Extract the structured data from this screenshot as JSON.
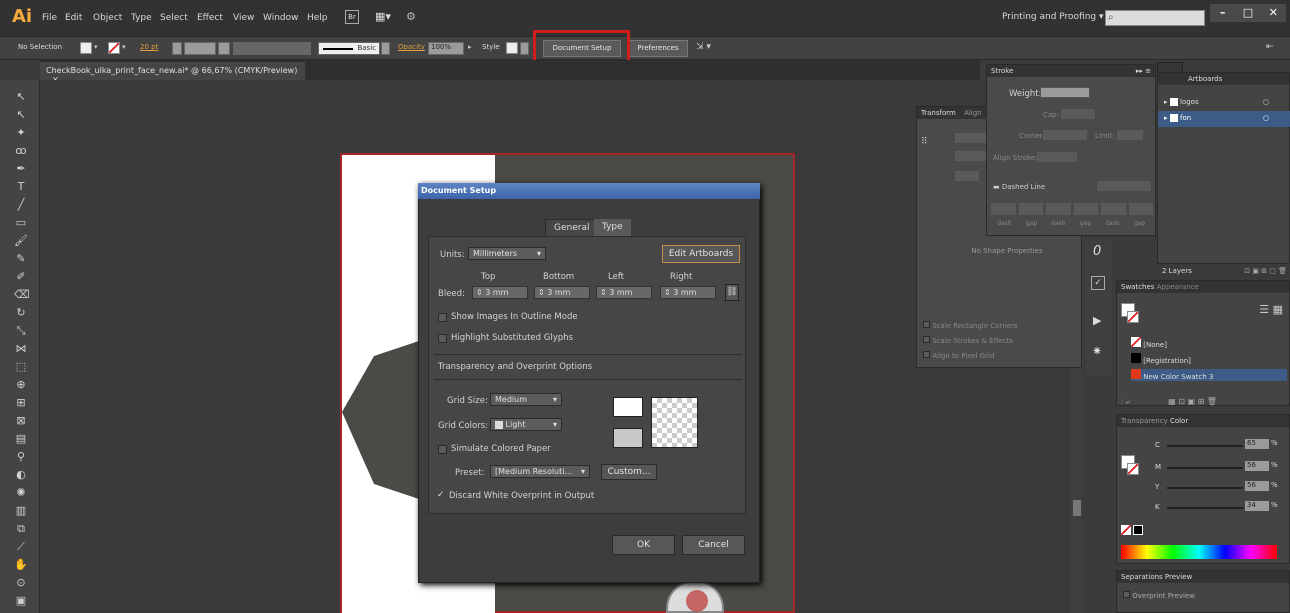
{
  "app": {
    "logo": "Ai",
    "menu": [
      "File",
      "Edit",
      "Object",
      "Type",
      "Select",
      "Effect",
      "View",
      "Window",
      "Help"
    ],
    "workspace": "Printing and Proofing",
    "window_buttons": [
      "–",
      "□",
      "✕"
    ]
  },
  "control_bar": {
    "no_selection": "No Selection",
    "stroke_size": "20 pt",
    "basic": "Basic",
    "opacity_label": "Opacity",
    "opacity_value": "100%",
    "style_label": "Style",
    "document_setup": "Document Setup",
    "preferences": "Preferences"
  },
  "document_tab": {
    "title": "CheckBook_ulka_print_face_new.ai* @ 66,67% (CMYK/Preview)",
    "close": "×"
  },
  "dialog": {
    "title": "Document Setup",
    "tabs": [
      "General",
      "Type"
    ],
    "units_label": "Units:",
    "units_value": "Millimeters",
    "edit_artboards": "Edit Artboards",
    "bleed_label": "Bleed:",
    "bleed_headers": [
      "Top",
      "Bottom",
      "Left",
      "Right"
    ],
    "bleed_values": [
      "3 mm",
      "3 mm",
      "3 mm",
      "3 mm"
    ],
    "show_images": "Show Images In Outline Mode",
    "highlight_glyphs": "Highlight Substituted Glyphs",
    "transparency_section": "Transparency and Overprint Options",
    "grid_size_label": "Grid Size:",
    "grid_size_value": "Medium",
    "grid_colors_label": "Grid Colors:",
    "grid_colors_value": "Light",
    "simulate_paper": "Simulate Colored Paper",
    "preset_label": "Preset:",
    "preset_value": "[Medium Resoluti...",
    "custom": "Custom...",
    "discard_white": "Discard White Overprint in Output",
    "ok": "OK",
    "cancel": "Cancel"
  },
  "stroke_panel": {
    "title": "Stroke",
    "weight": "Weight:",
    "cap": "Cap:",
    "corner": "Corner:",
    "limit": "Limit:",
    "align": "Align Stroke:",
    "dashed": "Dashed Line",
    "dash_labels": [
      "dash",
      "gap",
      "dash",
      "gap",
      "dash",
      "gap"
    ]
  },
  "transform_panel": {
    "title": "Transform",
    "tab2": "Align",
    "no_shape": "No Shape Properties",
    "options": [
      "Scale Rectangle Corners",
      "Scale Strokes & Effects",
      "Align to Pixel Grid"
    ]
  },
  "layers_panel": {
    "tab": "Artboards",
    "layers": [
      "logos",
      "fon"
    ],
    "count": "2 Layers"
  },
  "swatches_panel": {
    "tabs": [
      "Swatches",
      "Appearance"
    ],
    "items": [
      "[None]",
      "[Registration]",
      "New Color Swatch 3"
    ]
  },
  "color_panel": {
    "tabs": [
      "Transparency",
      "Color"
    ],
    "channels": [
      "C",
      "M",
      "Y",
      "K"
    ],
    "values": [
      "65",
      "56",
      "56",
      "34"
    ],
    "percent": "%"
  },
  "separations_panel": {
    "title": "Separations Preview",
    "overprint": "Overprint Preview"
  }
}
